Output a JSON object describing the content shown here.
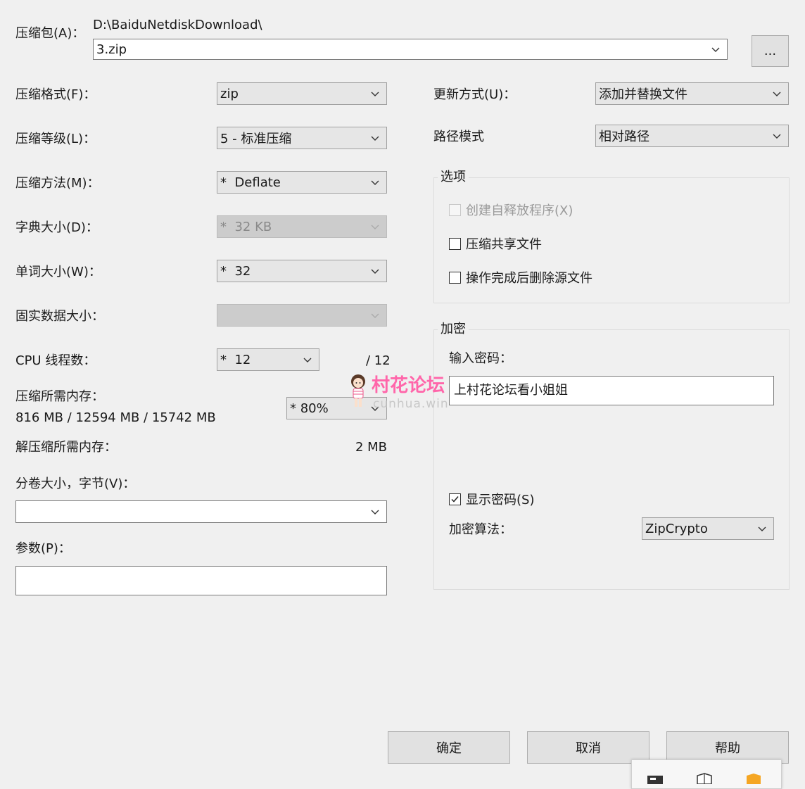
{
  "archive": {
    "label": "压缩包(A)：",
    "path": "D:\\BaiduNetdiskDownload\\",
    "filename": "3.zip",
    "browse_label": "..."
  },
  "left": {
    "format": {
      "label": "压缩格式(F)：",
      "value": "zip"
    },
    "level": {
      "label": "压缩等级(L)：",
      "value": "5 - 标准压缩"
    },
    "method": {
      "label": "压缩方法(M)：",
      "value": "*  Deflate"
    },
    "dict": {
      "label": "字典大小(D)：",
      "value": "*  32 KB"
    },
    "word": {
      "label": "单词大小(W)：",
      "value": "*  32"
    },
    "solid": {
      "label": "固实数据大小：",
      "value": ""
    },
    "threads": {
      "label": "CPU 线程数：",
      "value": "*  12",
      "max": "/ 12"
    },
    "mem_compress": {
      "label": "压缩所需内存：",
      "value": "816 MB / 12594 MB / 15742 MB",
      "percent": "* 80%"
    },
    "mem_decompress": {
      "label": "解压缩所需内存：",
      "value": "2 MB"
    },
    "volume": {
      "label": "分卷大小，字节(V)：",
      "value": ""
    },
    "params": {
      "label": "参数(P)：",
      "value": ""
    }
  },
  "right": {
    "update": {
      "label": "更新方式(U)：",
      "value": "添加并替换文件"
    },
    "pathmode": {
      "label": "路径模式",
      "value": "相对路径"
    },
    "options": {
      "title": "选项",
      "sfx": "创建自释放程序(X)",
      "shared": "压缩共享文件",
      "delete": "操作完成后删除源文件"
    },
    "encryption": {
      "title": "加密",
      "pw_label": "输入密码：",
      "pw_value": "上村花论坛看小姐姐",
      "show_pw": "显示密码(S)",
      "algo_label": "加密算法：",
      "algo_value": "ZipCrypto"
    }
  },
  "watermark": {
    "title": "村花论坛",
    "url": "cunhua.win"
  },
  "buttons": {
    "ok": "确定",
    "cancel": "取消",
    "help": "帮助"
  }
}
